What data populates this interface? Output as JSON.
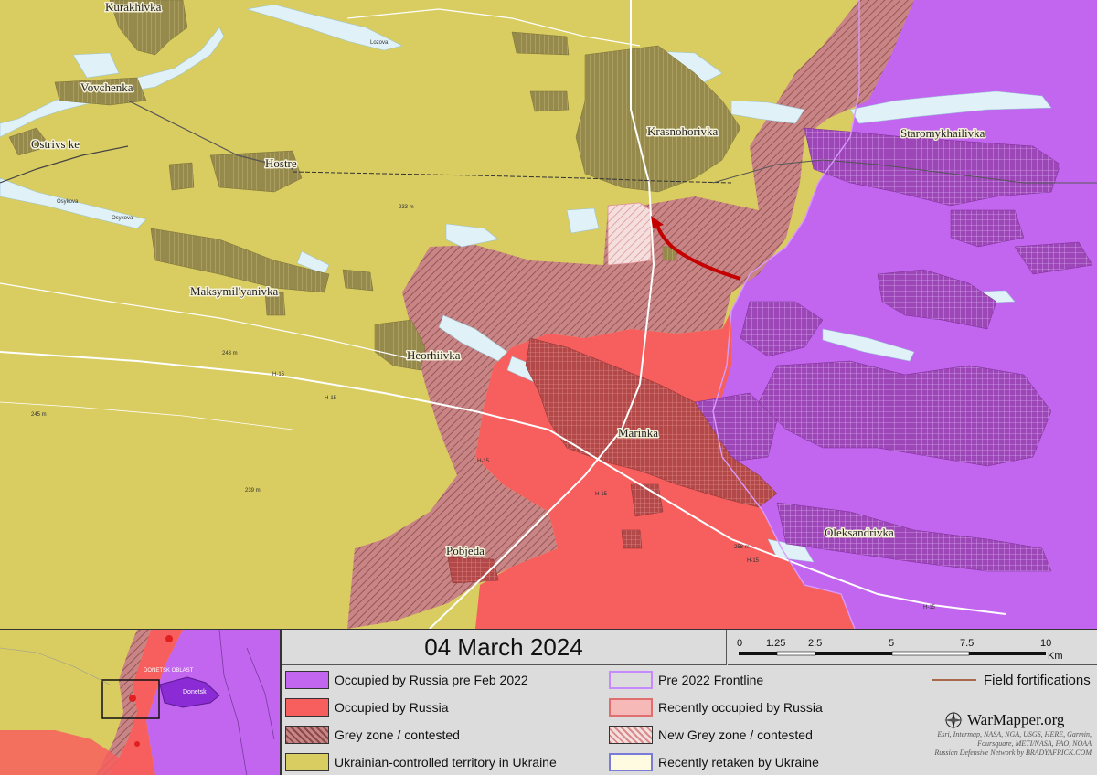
{
  "title": "04 March 2024",
  "colors": {
    "ukraine": "#d9cc61",
    "occupied_pre2022": "#c266f0",
    "occupied": "#f75e5e",
    "grey_zone": "#c98585",
    "new_grey": "#f2c6c6",
    "recent_occ": "#f7b8b8",
    "retaken": "#fffbe0",
    "settlement_ua": "#9a9050",
    "settlement_ru": "#9a45b0",
    "water": "#e0f2f8",
    "legend_bg": "#dcdcdc",
    "attack_arrow": "#c40000"
  },
  "towns": {
    "kurakhivka": "Kurakhivka",
    "vovchenka": "Vovchenka",
    "ostrivske": "Ostrivs ke",
    "hostre": "Hostre",
    "krasnohorivka": "Krasnohorivka",
    "staromykhailivka": "Staromykhailivka",
    "maksymilyanivka": "Maksymil'yanivka",
    "heorhiivka": "Heorhiivka",
    "marinka": "Marinka",
    "oleksandrivka": "Oleksandrivka",
    "pobjeda": "Pobjeda"
  },
  "roads": {
    "h15_a": "H-15",
    "h15_b": "H-15",
    "h15_c": "H-15",
    "h15_d": "H-15",
    "h15_e": "H-15",
    "h15_f": "H-15"
  },
  "rivers": {
    "lozova": "Lozova",
    "osykova_a": "Osykova",
    "osykova_b": "Osykova"
  },
  "elevations": {
    "e233": "233 m",
    "e243": "243 m",
    "e245": "245 m",
    "e239": "239 m",
    "e258": "258 m"
  },
  "inset": {
    "oblast_label": "DONETSK OBLAST",
    "city_label": "Donetsk"
  },
  "scale": {
    "ticks": [
      "0",
      "1.25",
      "2.5",
      "5",
      "7.5",
      "10"
    ],
    "unit": "Km"
  },
  "legend": {
    "occupied_pre2022": "Occupied by Russia pre Feb 2022",
    "occupied": "Occupied by Russia",
    "grey_zone": "Grey zone / contested",
    "ukraine": "Ukrainian-controlled territory in Ukraine",
    "frontline_2022": "Pre 2022 Frontline",
    "recent_occupied": "Recently occupied by Russia",
    "new_grey": "New Grey zone / contested",
    "retaken": "Recently retaken by Ukraine",
    "fortifications": "Field fortifications"
  },
  "brand": "WarMapper.org",
  "credits": [
    "Esri, Intermap, NASA, NGA, USGS, HERE, Garmin,",
    "Foursquare, METI/NASA, FAO, NOAA",
    "Russian Defensive Network by BRADYAFRICK.COM"
  ]
}
